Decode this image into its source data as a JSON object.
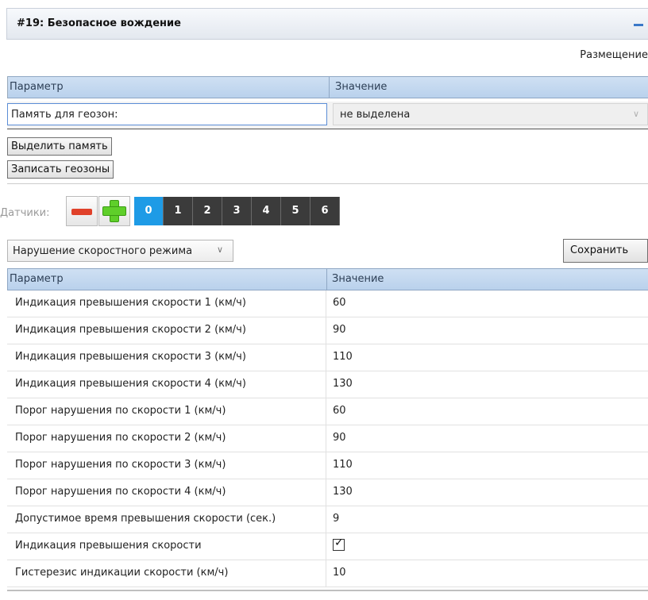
{
  "window": {
    "title": "#19: Безопасное вождение",
    "minimize_icon": "minimize-icon"
  },
  "placement_label": "Размещение",
  "memory_grid": {
    "header_param": "Параметр",
    "header_value": "Значение",
    "row_label": "Память для геозон:",
    "row_value": "не выделена"
  },
  "buttons": {
    "allocate_memory": "Выделить память",
    "write_geozones": "Записать геозоны",
    "save": "Сохранить"
  },
  "sensors": {
    "label": "Датчики:",
    "remove_icon": "minus-icon",
    "add_icon": "plus-icon",
    "tabs": [
      "0",
      "1",
      "2",
      "3",
      "4",
      "5",
      "6"
    ],
    "active_tab": "0"
  },
  "mode_dropdown": {
    "selected": "Нарушение скоростного режима"
  },
  "params_table": {
    "header_param": "Параметр",
    "header_value": "Значение",
    "rows": [
      {
        "param": "Индикация превышения скорости 1 (км/ч)",
        "value": "60"
      },
      {
        "param": "Индикация превышения скорости 2 (км/ч)",
        "value": "90"
      },
      {
        "param": "Индикация превышения скорости 3 (км/ч)",
        "value": "110"
      },
      {
        "param": "Индикация превышения скорости 4 (км/ч)",
        "value": "130"
      },
      {
        "param": "Порог нарушения по скорости 1 (км/ч)",
        "value": "60"
      },
      {
        "param": "Порог нарушения по скорости 2 (км/ч)",
        "value": "90"
      },
      {
        "param": "Порог нарушения по скорости 3 (км/ч)",
        "value": "110"
      },
      {
        "param": "Порог нарушения по скорости 4 (км/ч)",
        "value": "130"
      },
      {
        "param": "Допустимое время превышения скорости (сек.)",
        "value": "9"
      },
      {
        "param": "Индикация превышения скорости",
        "checked": true
      },
      {
        "param": "Гистерезис индикации скорости (км/ч)",
        "value": "10"
      }
    ]
  },
  "colors": {
    "accent": "#1e9be6",
    "header_bg": "#c4d8ef",
    "tab_bg": "#3b3b3b",
    "remove": "#e0412a",
    "add": "#5fcf2a"
  }
}
